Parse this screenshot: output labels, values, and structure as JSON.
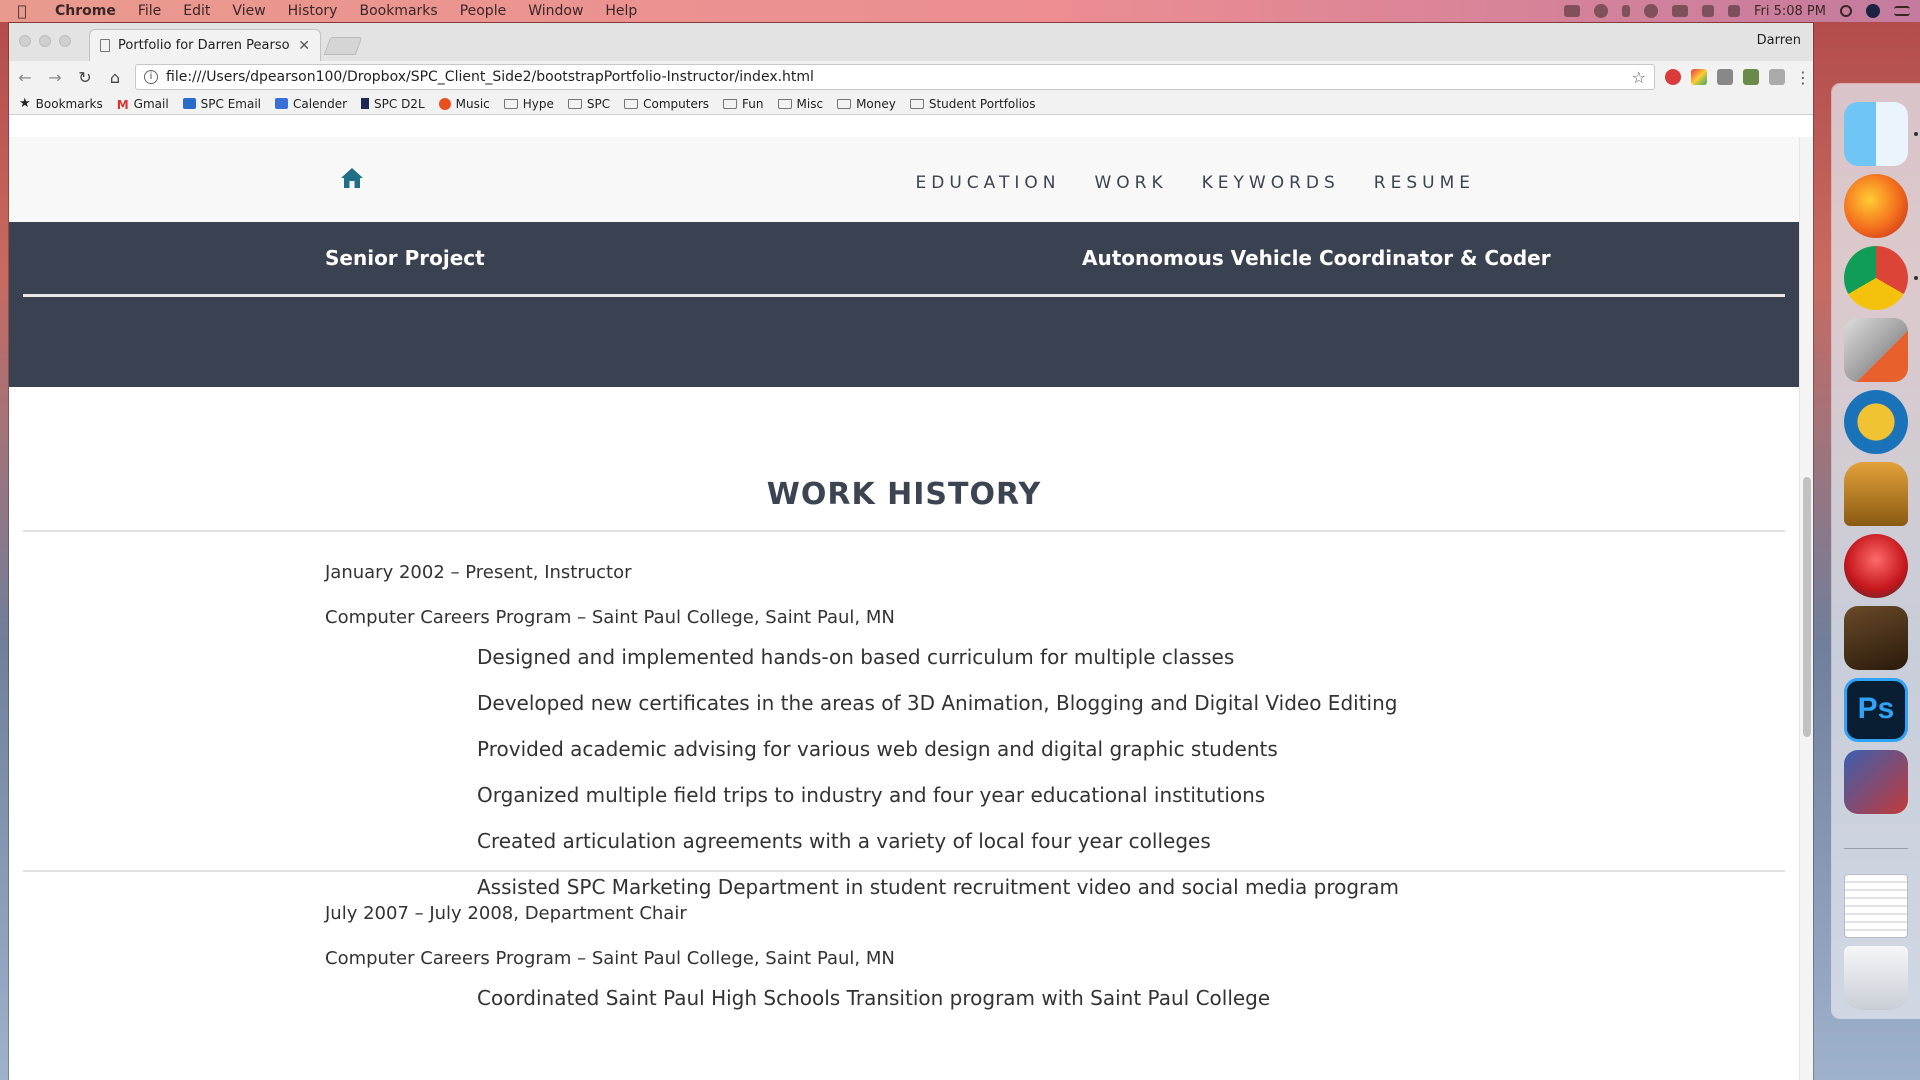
{
  "menubar": {
    "app": "Chrome",
    "items": [
      "File",
      "Edit",
      "View",
      "History",
      "Bookmarks",
      "People",
      "Window",
      "Help"
    ],
    "clock": "Fri 5:08 PM"
  },
  "browser": {
    "tab_title": "Portfolio for Darren Pearson",
    "profile_name": "Darren",
    "url": "file:///Users/dpearson100/Dropbox/SPC_Client_Side2/bootstrapPortfolio-Instructor/index.html",
    "bookmarks": [
      {
        "label": "Bookmarks",
        "icon": "star-icon"
      },
      {
        "label": "Gmail",
        "icon": "gmail-icon"
      },
      {
        "label": "SPC Email",
        "icon": "outlook-icon"
      },
      {
        "label": "Calender",
        "icon": "calendar-icon"
      },
      {
        "label": "SPC D2L",
        "icon": "d2l-icon"
      },
      {
        "label": "Music",
        "icon": "music-icon"
      },
      {
        "label": "Hype",
        "icon": "folder-icon"
      },
      {
        "label": "SPC",
        "icon": "folder-icon"
      },
      {
        "label": "Computers",
        "icon": "folder-icon"
      },
      {
        "label": "Fun",
        "icon": "folder-icon"
      },
      {
        "label": "Misc",
        "icon": "folder-icon"
      },
      {
        "label": "Money",
        "icon": "folder-icon"
      },
      {
        "label": "Student Portfolios",
        "icon": "folder-icon"
      }
    ]
  },
  "page": {
    "nav": {
      "links": [
        "EDUCATION",
        "WORK",
        "KEYWORDS",
        "RESUME"
      ]
    },
    "header": {
      "left_title": "Senior Project",
      "right_title": "Autonomous Vehicle Coordinator & Coder"
    },
    "section_title": "WORK HISTORY",
    "jobs": [
      {
        "dates": "January 2002 – Present, Instructor",
        "org": "Computer Careers Program – Saint Paul College, Saint Paul, MN",
        "bullets": [
          "Designed and implemented hands-on based curriculum for multiple classes",
          "Developed new certificates in the areas of 3D Animation, Blogging and Digital Video Editing",
          "Provided academic advising for various web design and digital graphic students",
          "Organized multiple field trips to industry and four year educational institutions",
          "Created articulation agreements with a variety of local four year colleges",
          "Assisted SPC Marketing Department in student recruitment video and social media program"
        ]
      },
      {
        "dates": "July 2007 – July 2008, Department Chair",
        "org": "Computer Careers Program – Saint Paul College, Saint Paul, MN",
        "bullets": [
          "Coordinated Saint Paul High Schools Transition program with Saint Paul College"
        ]
      }
    ]
  },
  "colors": {
    "header_band": "#3a4151",
    "home_icon": "#1f6f86",
    "nav_text": "#3d4451"
  },
  "dock": {
    "apps": [
      "finder-icon",
      "firefox-icon",
      "chrome-icon",
      "html5-editor-icon",
      "wordpress-icon",
      "transmit-icon",
      "crossover-icon",
      "garageband-icon",
      "photoshop-icon",
      "game-icon",
      "document-stack-icon",
      "trash-icon"
    ]
  }
}
